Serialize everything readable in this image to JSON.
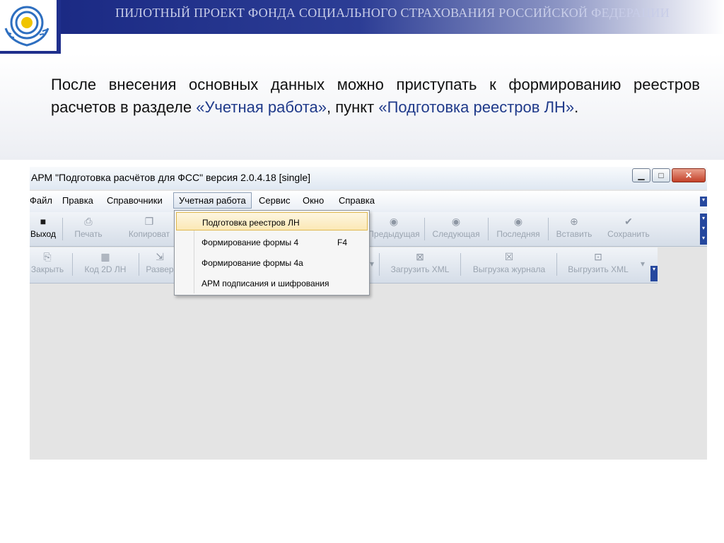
{
  "slide": {
    "title": "ПИЛОТНЫЙ ПРОЕКТ ФОНДА СОЦИАЛЬНОГО СТРАХОВАНИЯ РОССИЙСКОЙ ФЕДЕРАЦИИ",
    "intro_part1": "После внесения основных данных можно приступать к формированию реестров расчетов в разделе ",
    "intro_highlight1": "«Учетная работа»",
    "intro_part2": ", пункт ",
    "intro_highlight2": "«Подготовка реестров ЛН»",
    "intro_part3": "."
  },
  "colors": {
    "title_bar": "#1b2a84",
    "highlight_text": "#1f3a8a",
    "menu_highlight": "#fbe8b5"
  },
  "window": {
    "title": "АРМ \"Подготовка расчётов для ФСС\"   версия 2.0.4.18 [single]",
    "minimize": "▁",
    "maximize": "□",
    "close": "✕"
  },
  "menu": {
    "items": [
      "Файл",
      "Правка",
      "Справочники",
      "Учетная работа",
      "Сервис",
      "Окно",
      "Справка"
    ],
    "active": "Учетная работа"
  },
  "toolbar1": {
    "exit": "Выход",
    "print": "Печать",
    "copy": "Копироват",
    "previous": "Предыдущая",
    "next": "Следующая",
    "last": "Последняя",
    "insert": "Вставить",
    "save": "Сохранить"
  },
  "toolbar2": {
    "close": "Закрыть",
    "code2d": "Код 2D ЛН",
    "expand": "Развер",
    "load_xml": "Загрузить XML",
    "export_journal": "Выгрузка журнала",
    "export_xml": "Выгрузить XML"
  },
  "dropdown": {
    "items": [
      {
        "label": "Подготовка реестров ЛН",
        "shortcut": ""
      },
      {
        "label": "Формирование формы 4",
        "shortcut": "F4"
      },
      {
        "label": "Формирование формы 4а",
        "shortcut": ""
      },
      {
        "label": "АРМ подписания и шифрования",
        "shortcut": ""
      }
    ]
  }
}
